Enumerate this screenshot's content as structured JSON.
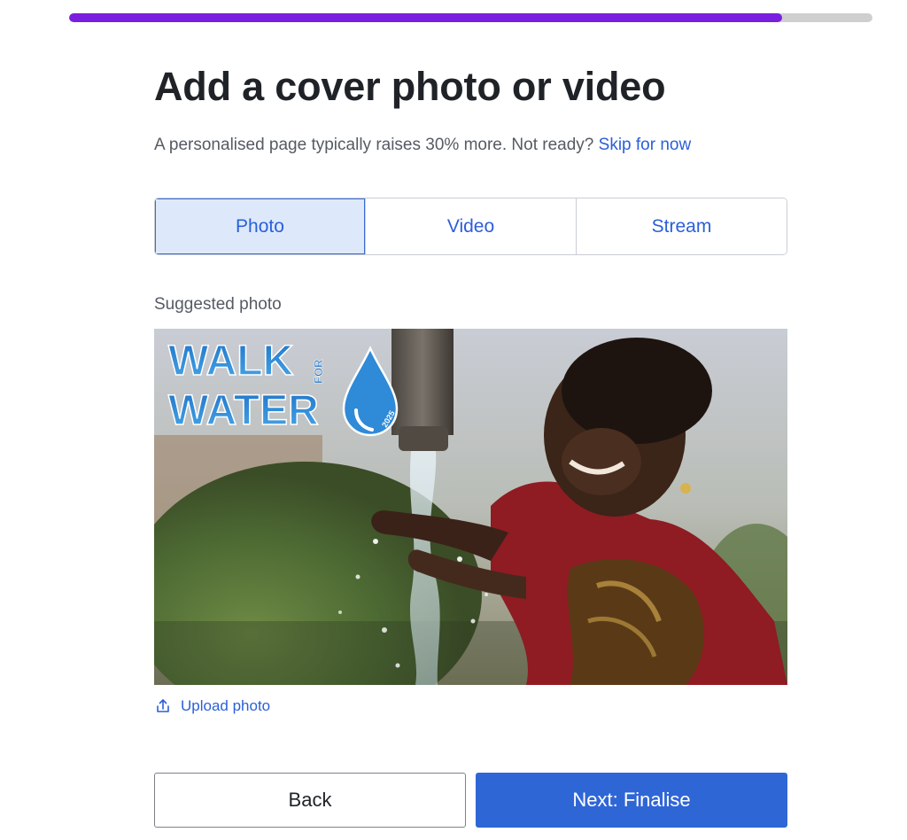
{
  "progress": {
    "fraction": 0.887
  },
  "page_title": "Add a cover photo or video",
  "subtitle": {
    "text": "A personalised page typically raises 30% more. Not ready? ",
    "skip_link": "Skip for now"
  },
  "tabs": [
    {
      "label": "Photo",
      "active": true
    },
    {
      "label": "Video",
      "active": false
    },
    {
      "label": "Stream",
      "active": false
    }
  ],
  "section_label": "Suggested photo",
  "photo": {
    "logo_text_line1": "WALK",
    "logo_text_small": "FOR",
    "logo_text_line2": "WATER",
    "logo_year": "2025"
  },
  "upload": {
    "label": "Upload photo",
    "icon": "upload-icon"
  },
  "buttons": {
    "back": "Back",
    "next": "Next: Finalise"
  },
  "colors": {
    "accent": "#2f66d6",
    "progress": "#7a1fe0",
    "link": "#2b5fd9",
    "active_tab_bg": "#dde9fb"
  }
}
